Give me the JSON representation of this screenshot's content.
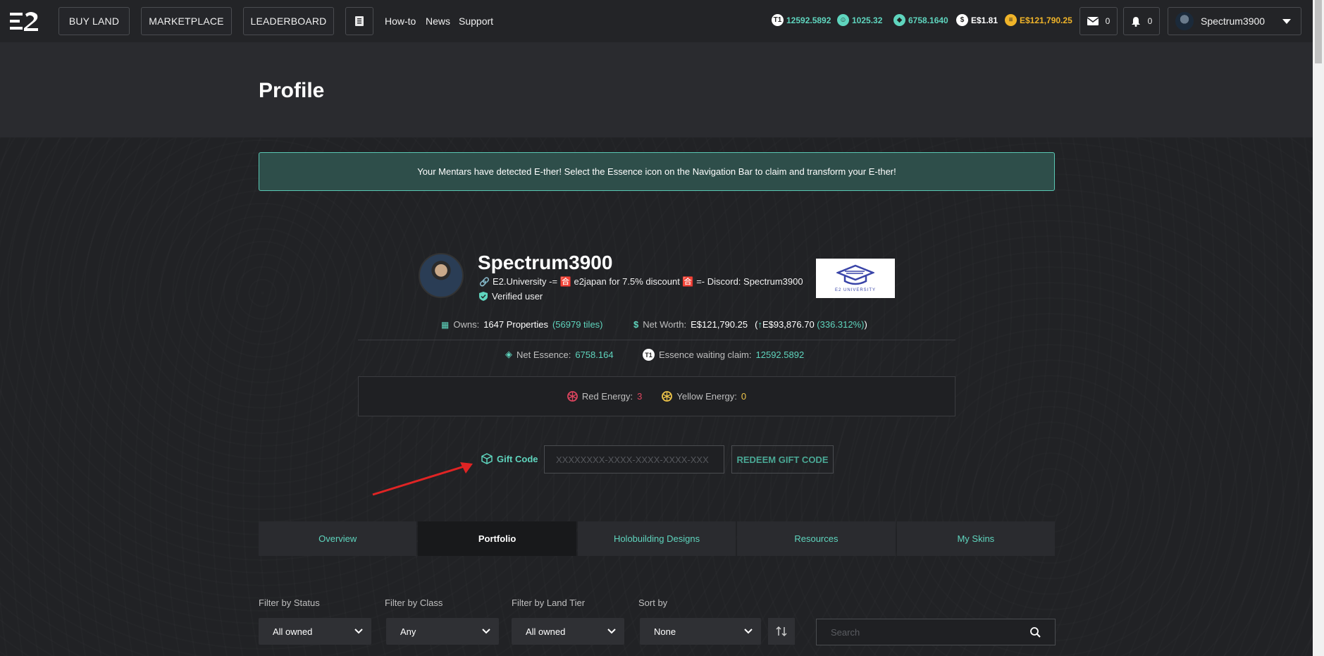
{
  "nav": {
    "buy_land": "BUY LAND",
    "marketplace": "MARKETPLACE",
    "leaderboard": "LEADERBOARD",
    "howto": "How-to",
    "news": "News",
    "support": "Support"
  },
  "stats": {
    "essence_claim": "12592.5892",
    "essence_claim_badge": "T1",
    "mentars": "1025.32",
    "essence": "6758.1640",
    "dollar": "E$1.81",
    "networth": "E$121,790.25",
    "mail_count": "0",
    "notif_count": "0",
    "username": "Spectrum3900"
  },
  "page": {
    "title": "Profile"
  },
  "notice": "Your Mentars have detected E-ther! Select the Essence icon on the Navigation Bar to claim and transform your E-ther!",
  "profile": {
    "username": "Spectrum3900",
    "bio": "E2.University -= 🈴 e2japan for 7.5% discount 🈴 =- Discord: Spectrum3900",
    "verified": "Verified user",
    "badge_caption": "E2 UNIVERSITY",
    "owns_label": "Owns:",
    "owns_value": "1647 Properties",
    "owns_tiles": "(56979 tiles)",
    "networth_label": "Net Worth:",
    "networth_value": "E$121,790.25",
    "networth_gain_open": "(",
    "networth_gain_arrow": "↑",
    "networth_gain": "E$93,876.70",
    "networth_pct": "(336.312%)",
    "networth_gain_close": ")",
    "net_essence_label": "Net Essence:",
    "net_essence_value": "6758.164",
    "essence_waiting_label": "Essence waiting claim:",
    "essence_waiting_value": "12592.5892",
    "essence_waiting_badge": "T1",
    "red_energy_label": "Red Energy:",
    "red_energy_value": "3",
    "yellow_energy_label": "Yellow Energy:",
    "yellow_energy_value": "0"
  },
  "gift": {
    "label": "Gift Code",
    "placeholder": "XXXXXXXX-XXXX-XXXX-XXXX-XXX",
    "redeem": "REDEEM GIFT CODE"
  },
  "tabs": [
    "Overview",
    "Portfolio",
    "Holobuilding Designs",
    "Resources",
    "My Skins"
  ],
  "filters": {
    "status_label": "Filter by Status",
    "status_value": "All owned",
    "class_label": "Filter by Class",
    "class_value": "Any",
    "tier_label": "Filter by Land Tier",
    "tier_value": "All owned",
    "sort_label": "Sort by",
    "sort_value": "None",
    "search_placeholder": "Search"
  },
  "colors": {
    "accent": "#5fd5be",
    "red": "#e0455f",
    "yellow": "#f0c64a",
    "gold": "#f0b429"
  }
}
